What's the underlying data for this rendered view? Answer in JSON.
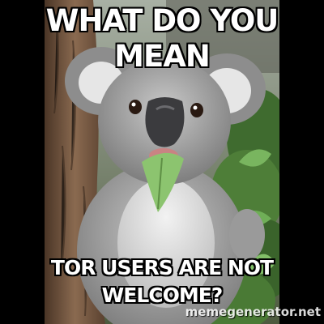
{
  "meme": {
    "top_lines": [
      "WHAT DO YOU",
      "MEAN"
    ],
    "bottom_lines": [
      "TOR USERS ARE NOT",
      "WELCOME?"
    ]
  },
  "watermark": {
    "text": "memegenerator.net"
  },
  "colors": {
    "background": "#000000",
    "caption": "#ffffff",
    "koala_fur": "#9b9b9b",
    "leaf": "#6fae57",
    "tree_bark": "#7a5a43"
  }
}
